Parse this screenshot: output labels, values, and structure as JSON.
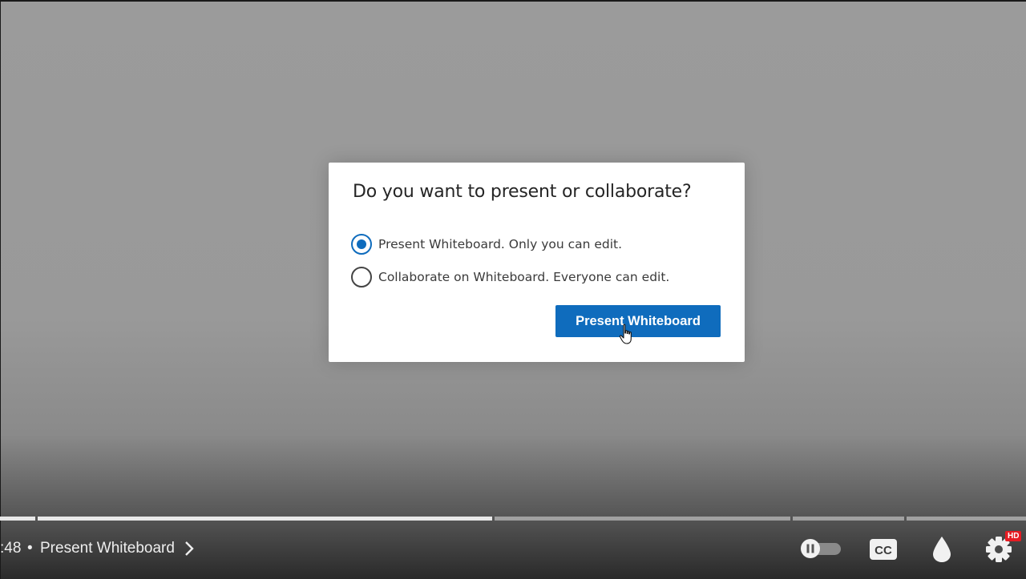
{
  "dialog": {
    "title": "Do you want to present or collaborate?",
    "options": [
      {
        "label": "Present Whiteboard. Only you can edit.",
        "checked": true
      },
      {
        "label": "Collaborate on Whiteboard. Everyone can edit.",
        "checked": false
      }
    ],
    "primary_button": "Present Whiteboard"
  },
  "player": {
    "time": ":48",
    "separator": "•",
    "chapter_title": "Present Whiteboard",
    "hd_badge": "HD",
    "icons": [
      "chevron-right-icon",
      "autoplay-toggle-icon",
      "closed-captions-icon",
      "ambient-drop-icon",
      "settings-gear-icon"
    ],
    "colors": {
      "accent": "#0f6cbd",
      "hd_badge": "#e51c23"
    }
  }
}
